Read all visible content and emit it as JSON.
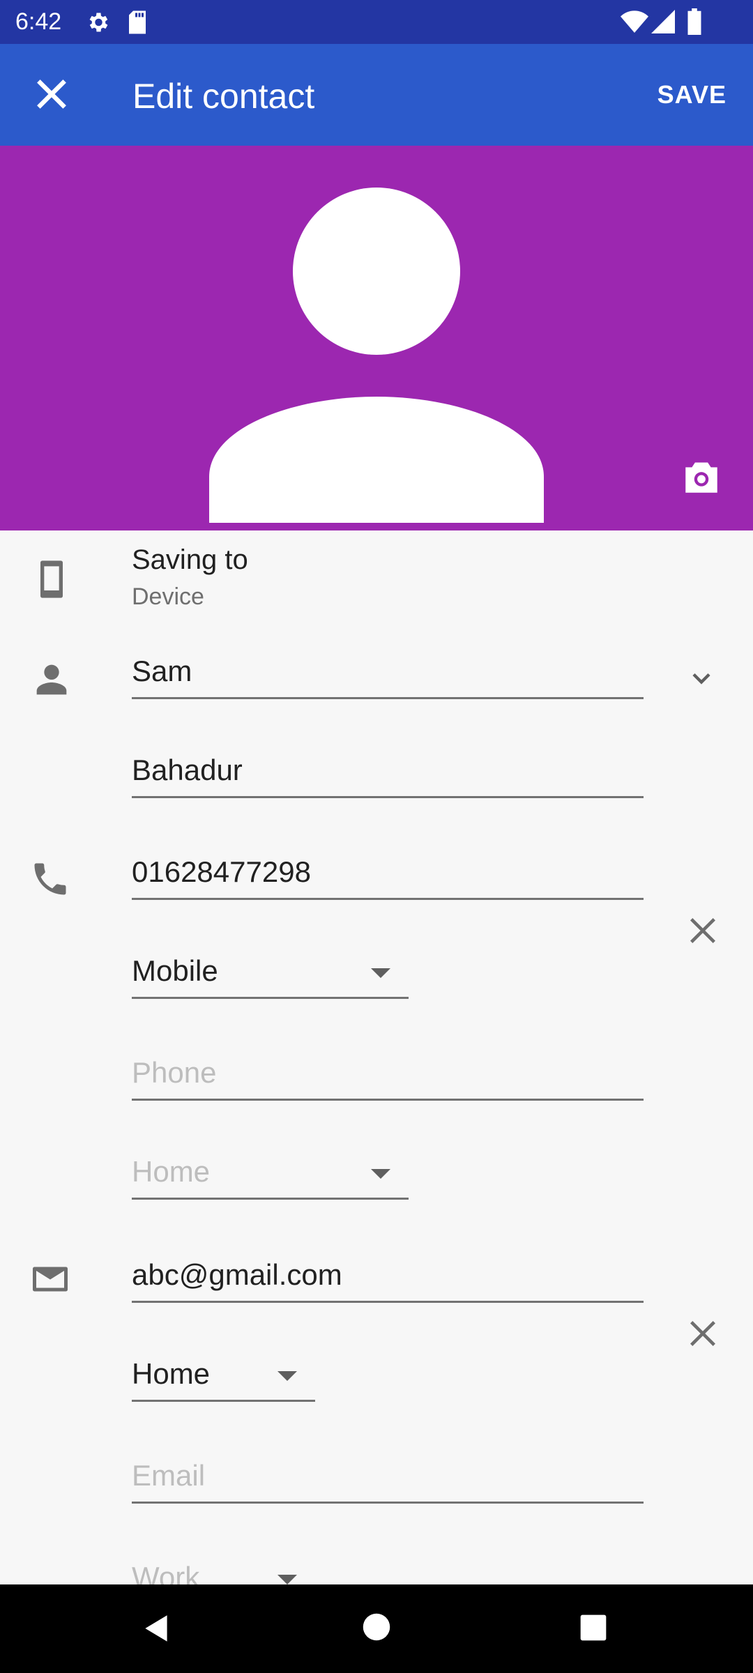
{
  "status_bar": {
    "time": "6:42"
  },
  "app_bar": {
    "title": "Edit contact",
    "save_label": "SAVE"
  },
  "saving_to": {
    "title": "Saving to",
    "account": "Device"
  },
  "name": {
    "first": "Sam",
    "last": "Bahadur"
  },
  "phone": {
    "number": "01628477298",
    "type": "Mobile",
    "new_placeholder": "Phone",
    "new_type": "Home"
  },
  "email": {
    "address": "abc@gmail.com",
    "type": "Home",
    "new_placeholder": "Email",
    "new_type": "Work"
  },
  "colors": {
    "status_bar": "#2336a3",
    "app_bar": "#2c5acb",
    "photo_bg": "#9c27b0",
    "background": "#f7f7f7"
  }
}
